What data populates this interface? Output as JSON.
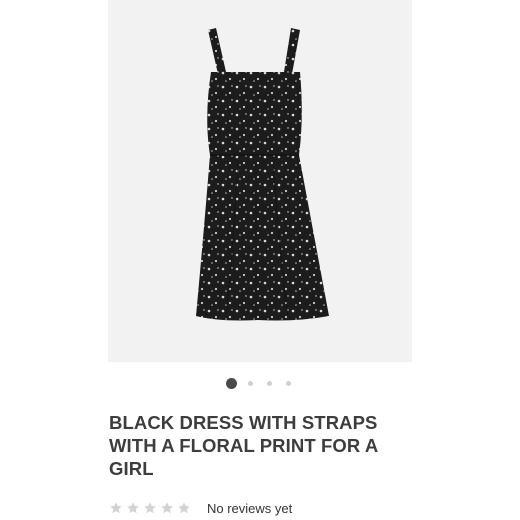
{
  "product": {
    "title_lines": [
      "BLACK DRESS WITH STRAPS",
      "WITH A FLORAL PRINT FOR A",
      "GIRL"
    ],
    "image_alt": "Black floral dress with straps",
    "colors": {
      "dress": "#1c1c1c",
      "print": "#d9d9d9",
      "image_background": "#f2f2f2",
      "title": "#3d3d3d"
    }
  },
  "carousel": {
    "total": 4,
    "active_index": 0
  },
  "reviews": {
    "rating": 0,
    "max_rating": 5,
    "text": "No reviews yet"
  },
  "icons": {
    "wishlist": "heart-outline-icon",
    "star": "star-icon"
  }
}
